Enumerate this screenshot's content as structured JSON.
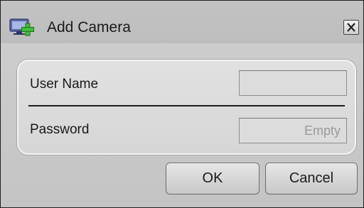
{
  "dialog": {
    "title": "Add Camera",
    "title_icon": "add-camera-icon",
    "close_icon": "close-icon"
  },
  "form": {
    "username_label": "User Name",
    "username_value": "",
    "password_label": "Password",
    "password_placeholder": "Empty"
  },
  "buttons": {
    "ok_label": "OK",
    "cancel_label": "Cancel"
  },
  "colors": {
    "icon_monitor": "#5a6aa8",
    "icon_plus": "#3fbf3a"
  }
}
